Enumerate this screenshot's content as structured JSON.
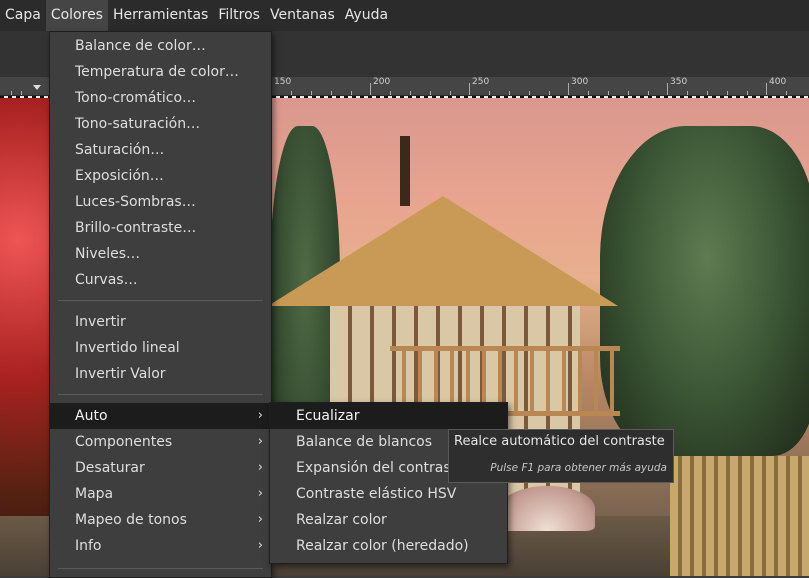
{
  "menubar": {
    "items": [
      {
        "label": "Capa",
        "active": false
      },
      {
        "label": "Colores",
        "active": true
      },
      {
        "label": "Herramientas",
        "active": false
      },
      {
        "label": "Filtros",
        "active": false
      },
      {
        "label": "Ventanas",
        "active": false
      },
      {
        "label": "Ayuda",
        "active": false
      }
    ]
  },
  "ruler": {
    "labels": [
      "150",
      "200",
      "250",
      "300",
      "350",
      "400"
    ]
  },
  "colores_menu": {
    "items": [
      "Balance de color…",
      "Temperatura de color…",
      "Tono-cromático…",
      "Tono-saturación…",
      "Saturación…",
      "Exposición…",
      "Luces-Sombras…",
      "Brillo-contraste…",
      "Niveles…",
      "Curvas…"
    ],
    "invert_items": [
      "Invertir",
      "Invertido lineal",
      "Invertir Valor"
    ],
    "submenu_items": [
      "Auto",
      "Componentes",
      "Desaturar",
      "Mapa",
      "Mapeo de tonos",
      "Info"
    ],
    "highlighted": "Auto",
    "arrow_glyph": "›"
  },
  "auto_submenu": {
    "items": [
      "Ecualizar",
      "Balance de blancos",
      "Expansión del contraste",
      "Contraste elástico HSV",
      "Realzar color",
      "Realzar color  (heredado)"
    ],
    "highlighted": "Ecualizar"
  },
  "tooltip": {
    "title": "Realce automático del contraste",
    "hint": "Pulse F1 para obtener más ayuda"
  },
  "colors": {
    "menu_bg": "#3e3e3e",
    "highlight_bg": "#1c1c1c",
    "menubar_bg": "#2b2b2b"
  }
}
